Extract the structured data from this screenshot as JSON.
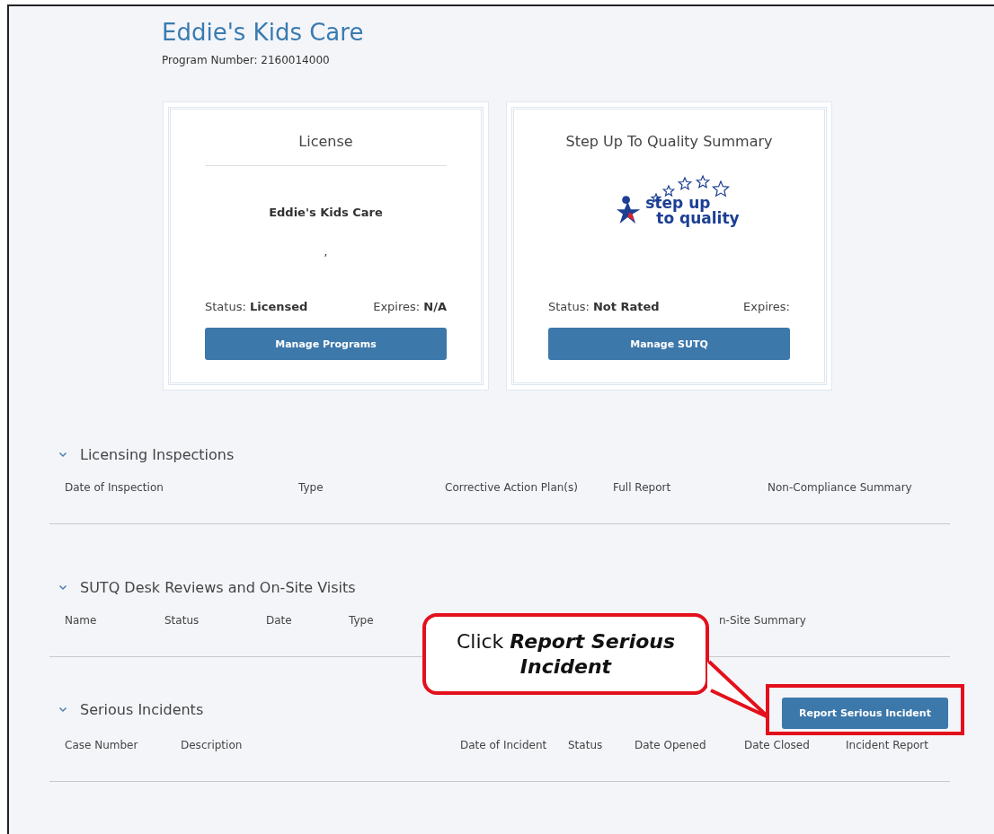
{
  "header": {
    "title": "Eddie's Kids Care",
    "program_number": "Program Number: 2160014000"
  },
  "cards": [
    {
      "kind": "license",
      "title": "License",
      "name": "Eddie's Kids Care",
      "address": ",",
      "status_label": "Status:",
      "status": "Licensed",
      "expires_label": "Expires:",
      "expires": "N/A",
      "button": "Manage Programs"
    },
    {
      "kind": "sutq",
      "title": "Step Up To Quality Summary",
      "logo": {
        "line_1": "step up",
        "line_2": "to quality"
      },
      "status_label": "Status:",
      "status": "Not Rated",
      "expires_label": "Expires:",
      "button": "Manage SUTQ"
    }
  ],
  "sections": [
    {
      "title": "Licensing Inspections",
      "expanded": true,
      "columns": [
        "Date of Inspection",
        "Type",
        "Corrective Action Plan(s)",
        "Full Report",
        "Non-Compliance Summary"
      ]
    },
    {
      "title": "SUTQ Desk Reviews and On-Site Visits",
      "expanded": true,
      "columns": [
        "Name",
        "Status",
        "Date",
        "Type",
        "n-Site Summary"
      ]
    },
    {
      "title": "Serious Incidents",
      "expanded": true,
      "action": {
        "label": "Report Serious Incident",
        "highlighted": true
      },
      "columns": [
        "Case Number",
        "Description",
        "Date of Incident",
        "Status",
        "Date Opened",
        "Date Closed",
        "Incident Report"
      ]
    }
  ],
  "callout": {
    "text": "Click **Report Serious Incident**"
  }
}
